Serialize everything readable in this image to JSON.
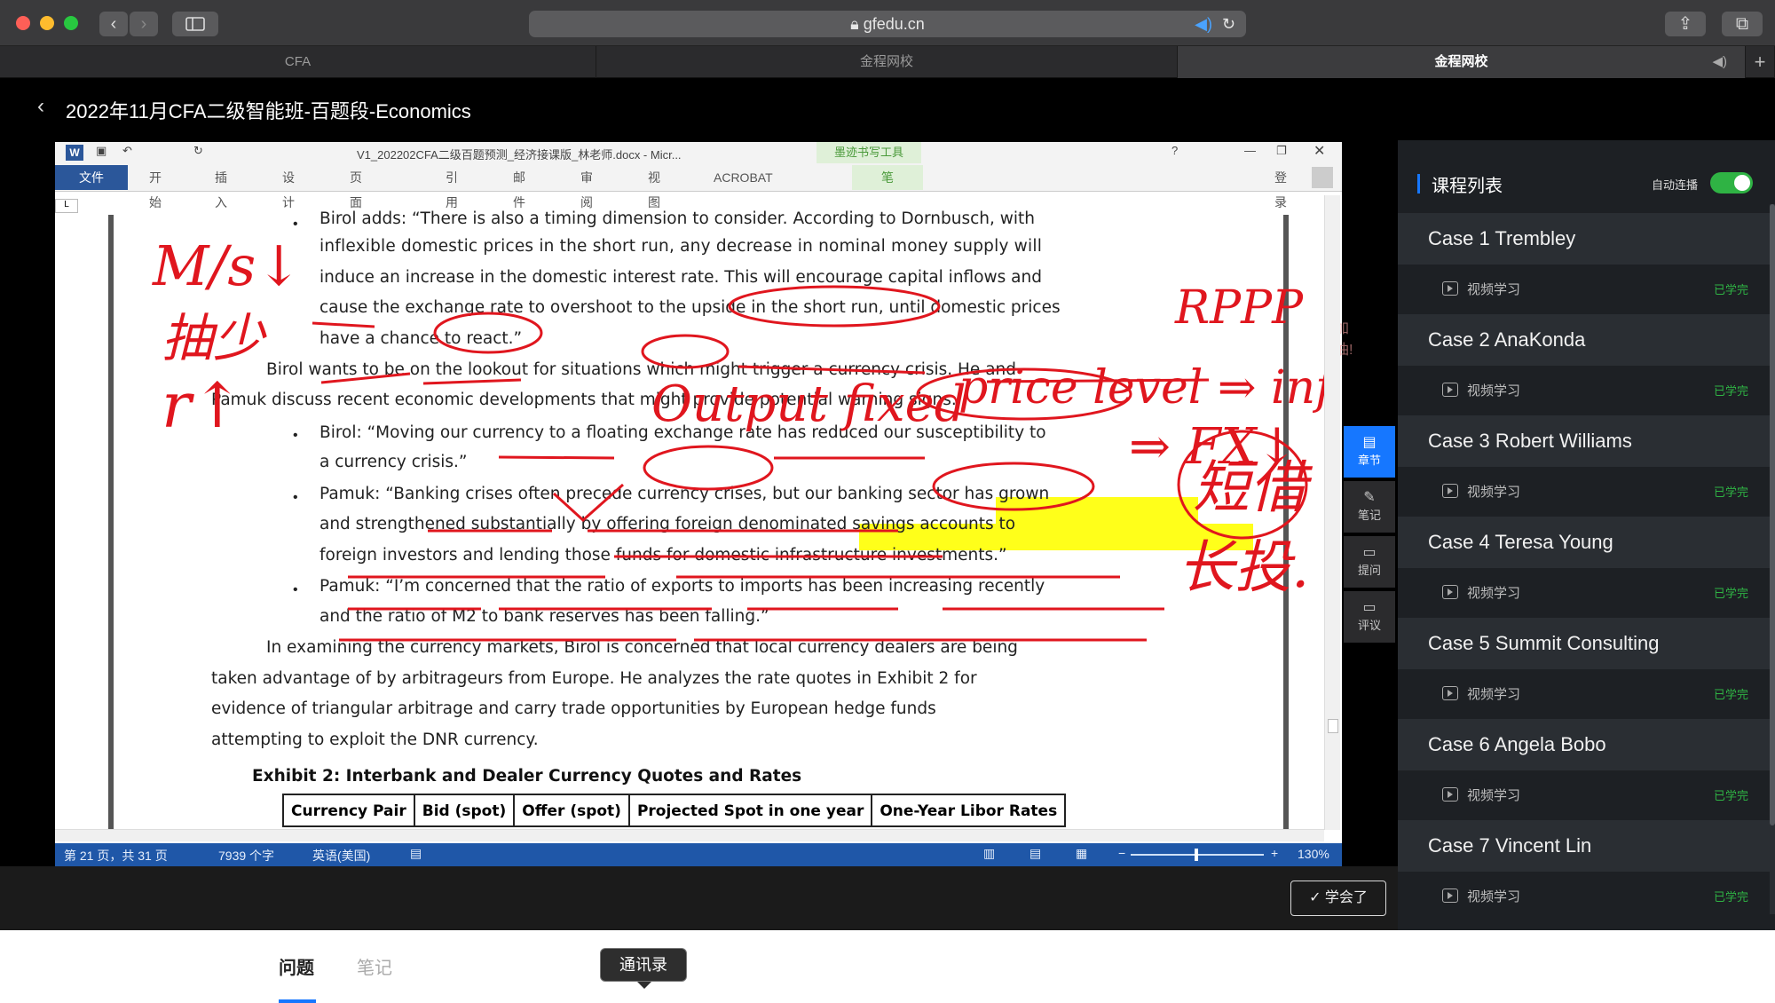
{
  "browser": {
    "url": "gfedu.cn",
    "tabs": [
      {
        "label": "CFA"
      },
      {
        "label": "金程网校"
      },
      {
        "label": "金程网校"
      }
    ]
  },
  "header": {
    "title": "2022年11月CFA二级智能班-百题段-Economics"
  },
  "document": {
    "window_title": "V1_202202CFA二级百题预测_经济接课版_林老师.docx - Micr...",
    "ink_tool_label": "墨迹书写工具",
    "ink_sub_label": "笔",
    "signin": "登录",
    "menu": [
      "文件",
      "开始",
      "插入",
      "设计",
      "页面布局",
      "引用",
      "邮件",
      "审阅",
      "视图",
      "ACROBAT"
    ],
    "lines": [
      "Birol adds: “There is also a timing dimension to consider. According to Dornbusch, with",
      "inflexible domestic prices in the short run, any decrease in nominal money supply will",
      "induce an increase in the domestic interest rate. This will encourage capital inflows and",
      "cause the exchange rate to overshoot to the upside in the short run, until domestic prices",
      "have a chance to react.”",
      "Birol wants to be on the lookout for situations which might trigger a currency crisis. He and",
      "Pamuk discuss recent economic developments that might provide potential warning signs.",
      "Birol: “Moving our currency to a floating exchange rate has reduced our susceptibility to",
      "a currency crisis.”",
      "Pamuk: “Banking crises often precede currency crises, but our banking sector has grown",
      "and strengthened substantially by offering foreign denominated savings accounts to",
      "foreign investors and lending those funds for domestic infrastructure investments.”",
      "Pamuk: “I’m concerned that the ratio of exports to imports has been increasing recently",
      "and the ratio of M2 to bank reserves has been falling.”",
      "In examining the currency markets, Birol is concerned that local currency dealers are being",
      "taken advantage of by arbitrageurs from Europe. He analyzes the rate quotes in Exhibit 2 for",
      "evidence of triangular arbitrage and carry trade opportunities by European hedge funds",
      "attempting to exploit the DNR currency."
    ],
    "exhibit_title": "Exhibit 2: Interbank and Dealer Currency Quotes and Rates",
    "table_headers": [
      "Currency Pair",
      "Bid (spot)",
      "Offer (spot)",
      "Projected Spot in one year",
      "One-Year Libor Rates"
    ],
    "status": {
      "page": "第 21 页，共 31 页",
      "words": "7939 个字",
      "lang": "英语(美国)",
      "zoom": "130%"
    },
    "handwriting": {
      "left1": "M/s↓",
      "left2": "抽少",
      "left3": "r↑",
      "right1": "RPPP",
      "mid": "Output fixed",
      "price": "price level ⇒ inf",
      "fx": "⇒ FX↓",
      "cn1": "短借",
      "cn2": "长投."
    },
    "overlay_text": "加油!"
  },
  "side_tools": [
    {
      "label": "章节",
      "icon": "chapter-icon"
    },
    {
      "label": "笔记",
      "icon": "pen-icon"
    },
    {
      "label": "提问",
      "icon": "question-icon"
    },
    {
      "label": "评议",
      "icon": "comment-icon"
    }
  ],
  "sidebar": {
    "title": "课程列表",
    "autoplay_label": "自动连播",
    "autoplay_on": true,
    "accent": "#2fb344",
    "cases": [
      {
        "title": "Case 1 Trembley",
        "sub": "视频学习",
        "status": "已学完"
      },
      {
        "title": "Case 2 AnaKonda",
        "sub": "视频学习",
        "status": "已学完"
      },
      {
        "title": "Case 3 Robert Williams",
        "sub": "视频学习",
        "status": "已学完"
      },
      {
        "title": "Case 4 Teresa Young",
        "sub": "视频学习",
        "status": "已学完"
      },
      {
        "title": "Case 5 Summit Consulting",
        "sub": "视频学习",
        "status": "已学完"
      },
      {
        "title": "Case 6 Angela Bobo",
        "sub": "视频学习",
        "status": "已学完"
      },
      {
        "title": "Case 7 Vincent Lin",
        "sub": "视频学习",
        "status": "已学完"
      }
    ]
  },
  "learn_button": "✓ 学会了",
  "bottom": {
    "tabs": [
      "问题",
      "笔记"
    ],
    "tooltip": "通讯录"
  }
}
